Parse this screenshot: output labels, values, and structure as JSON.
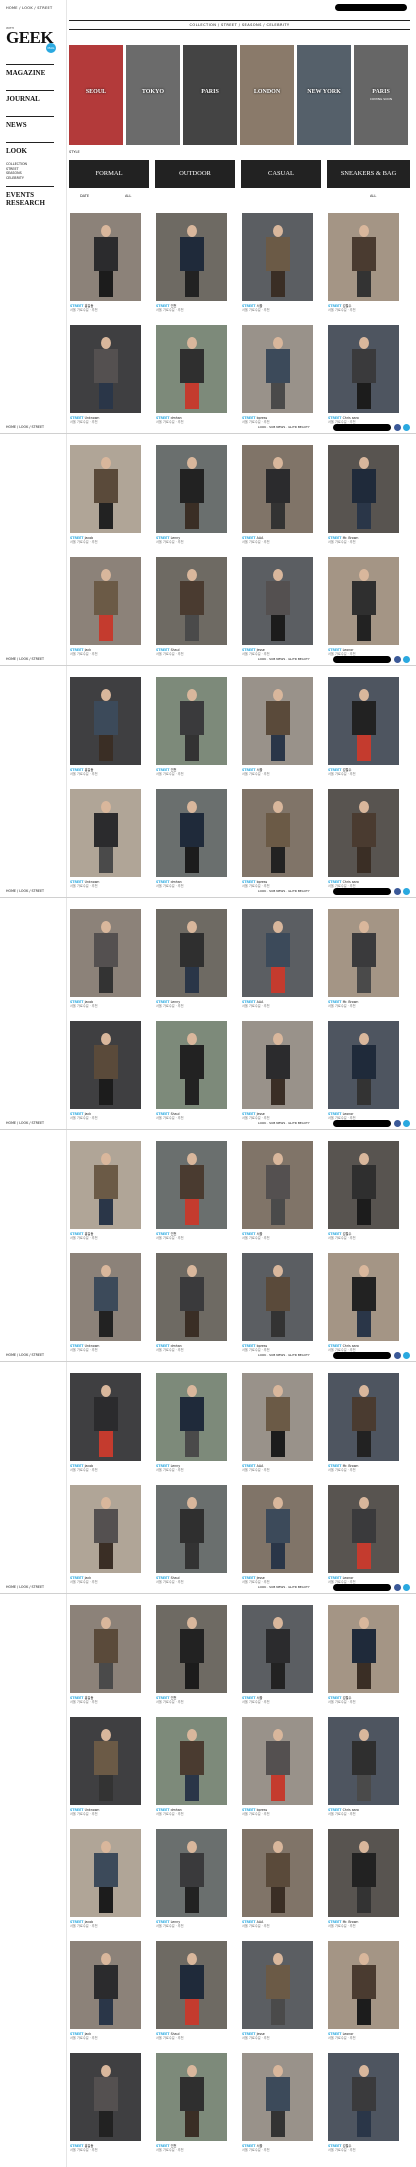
{
  "breadcrumb": "HOME / LOOK / STREET",
  "logo": {
    "small": "WITH",
    "word": "GEEK",
    "dot": "MAG"
  },
  "side_menu": {
    "magazine": "MAGAZINE",
    "journal": "JOURNAL",
    "news": "NEWS",
    "look": "LOOK",
    "look_sub": [
      "COLLECTION",
      "STREET",
      "SEASONS",
      "CELEBRITY"
    ],
    "events": "EVENTS RESEARCH"
  },
  "topnav": "COLLECTION / STREET / SEASONS / CELEBRITY",
  "hero_tiles": [
    {
      "city": "SEOUL",
      "color": "#b33a3a"
    },
    {
      "city": "TOKYO",
      "color": "#6b6b6b"
    },
    {
      "city": "PARIS",
      "color": "#444"
    },
    {
      "city": "LONDON",
      "color": "#8a7a6a"
    },
    {
      "city": "NEW YORK",
      "color": "#55606a"
    },
    {
      "city": "PARIS",
      "sub": "COMING SOON",
      "color": "#666"
    }
  ],
  "style_label": "STYLE",
  "categories": [
    "FORMAL",
    "OUTDOOR",
    "CASUAL",
    "SNEAKERS & BAG"
  ],
  "pager": {
    "left": "DATE",
    "left_sel": "ALL",
    "right": "ALL"
  },
  "toolbar_links": "LOOK · SUB NEWS · GLITR BEAUTY",
  "caption_tag": "STREET",
  "caption_names": [
    "홍길동",
    "인천",
    "서울",
    "김철수",
    "Unknown",
    "dmhan",
    "bpress",
    "Chris aaro",
    "Jacob",
    "Lenny",
    "AAA",
    "Mr. Brown",
    "Jack",
    "Shaul",
    "Jesse",
    "Leonor"
  ],
  "caption_detail": "서울 가로수길 · 추천"
}
